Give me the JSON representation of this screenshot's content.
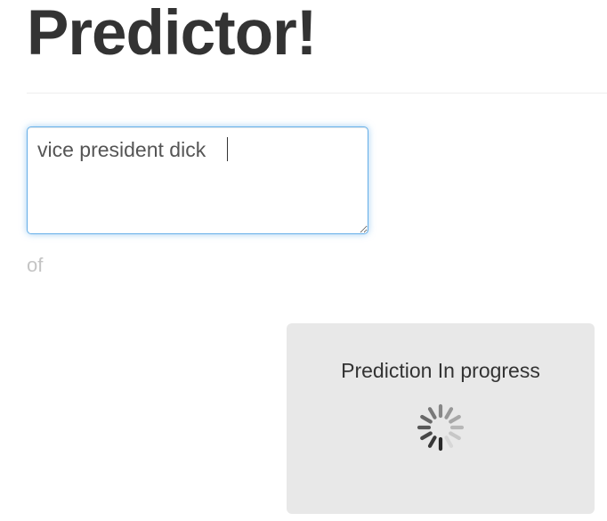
{
  "header": {
    "title": "Predictor!"
  },
  "input": {
    "value": "vice president dick "
  },
  "prediction": {
    "word": "of"
  },
  "progress": {
    "message": "Prediction In progress",
    "spinner_icon": "loading-spinner-icon"
  },
  "colors": {
    "focus_border": "#66afe9",
    "panel_background": "#e8e8e8",
    "muted_text": "#c4c4c4",
    "title_text": "#333333"
  }
}
